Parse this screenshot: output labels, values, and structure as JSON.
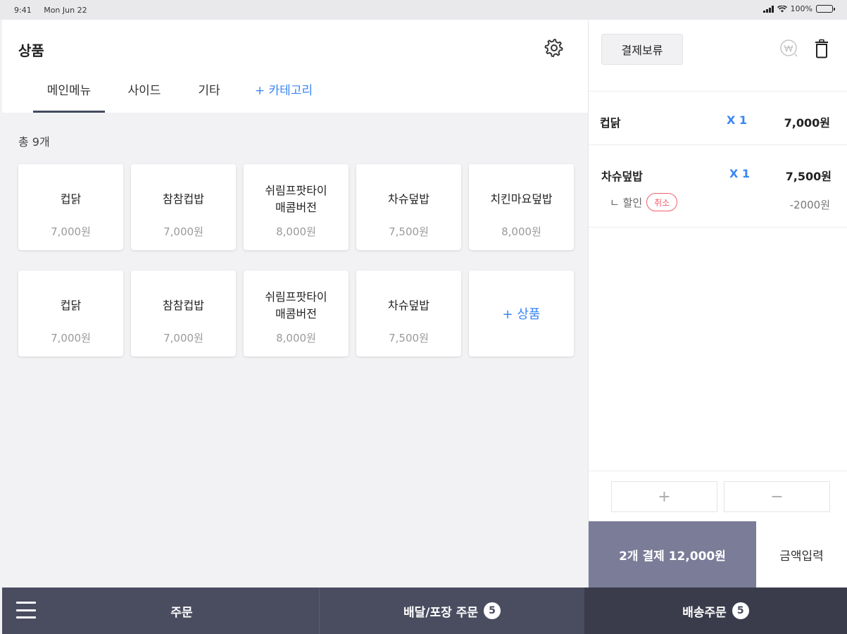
{
  "status_bar": {
    "time": "9:41",
    "date": "Mon Jun 22",
    "battery": "100%"
  },
  "products": {
    "title": "상품",
    "tabs": [
      {
        "label": "메인메뉴",
        "active": true
      },
      {
        "label": "사이드"
      },
      {
        "label": "기타"
      },
      {
        "label": "+ 카테고리"
      }
    ],
    "total_count": "총 9개",
    "items": [
      {
        "name": "컵닭",
        "price": "7,000원"
      },
      {
        "name": "참참컵밥",
        "price": "7,000원"
      },
      {
        "name": "쉬림프팟타이\n매콤버전",
        "price": "8,000원"
      },
      {
        "name": "차슈덮밥",
        "price": "7,500원"
      },
      {
        "name": "치킨마요덮밥",
        "price": "8,000원"
      },
      {
        "name": "컵닭",
        "price": "7,000원"
      },
      {
        "name": "참참컵밥",
        "price": "7,000원"
      },
      {
        "name": "쉬림프팟타이\n매콤버전",
        "price": "8,000원"
      },
      {
        "name": "차슈덮밥",
        "price": "7,500원"
      }
    ],
    "add_product_label": "+ 상품"
  },
  "order": {
    "hold_label": "결제보류",
    "items": [
      {
        "name": "컵닭",
        "qty": "X 1",
        "price": "7,000원"
      },
      {
        "name": "차슈덮밥",
        "qty": "X 1",
        "price": "7,500원",
        "discount_label": "ㄴ 할인",
        "cancel_label": "취소",
        "discount_amount": "-2000원"
      }
    ],
    "plus_label": "+",
    "minus_label": "−",
    "pay_label": "2개 결제 12,000원",
    "amount_input_label": "금액입력"
  },
  "bottom_nav": {
    "order_label": "주문",
    "delivery_takeout_label": "배달/포장 주문",
    "delivery_takeout_badge": "5",
    "shipping_label": "배송주문",
    "shipping_badge": "5"
  },
  "colors": {
    "accent": "#3a86f4",
    "pay_button": "#7a7c98",
    "bottom_bar": "#4a4d60",
    "cancel_red": "#f0606b"
  }
}
